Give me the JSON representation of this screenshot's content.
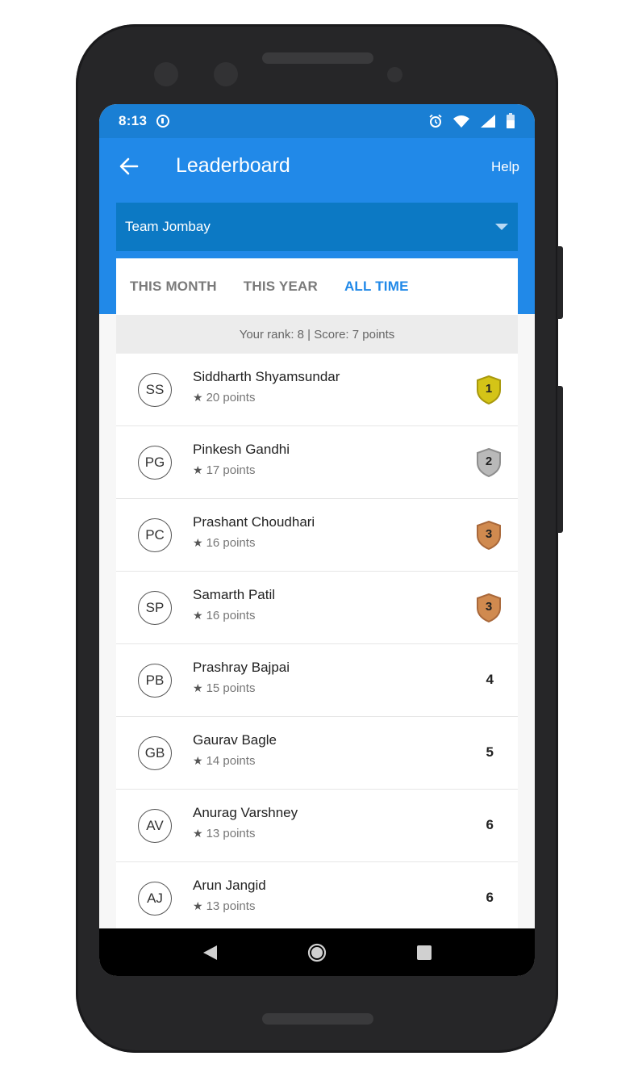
{
  "status": {
    "time": "8:13"
  },
  "appbar": {
    "title": "Leaderboard",
    "help_label": "Help"
  },
  "team_select": {
    "value": "Team Jombay"
  },
  "tabs": [
    {
      "label": "THIS MONTH",
      "active": false
    },
    {
      "label": "THIS YEAR",
      "active": false
    },
    {
      "label": "ALL TIME",
      "active": true
    }
  ],
  "your_rank": "Your rank: 8 | Score: 7 points",
  "leaders": [
    {
      "initials": "SS",
      "name": "Siddharth Shyamsundar",
      "points": "20 points",
      "rank": "1",
      "badge": "gold"
    },
    {
      "initials": "PG",
      "name": "Pinkesh Gandhi",
      "points": "17 points",
      "rank": "2",
      "badge": "silver"
    },
    {
      "initials": "PC",
      "name": "Prashant Choudhari",
      "points": "16 points",
      "rank": "3",
      "badge": "bronze"
    },
    {
      "initials": "SP",
      "name": "Samarth Patil",
      "points": "16 points",
      "rank": "3",
      "badge": "bronze"
    },
    {
      "initials": "PB",
      "name": "Prashray Bajpai",
      "points": "15 points",
      "rank": "4",
      "badge": ""
    },
    {
      "initials": "GB",
      "name": "Gaurav Bagle",
      "points": "14 points",
      "rank": "5",
      "badge": ""
    },
    {
      "initials": "AV",
      "name": "Anurag Varshney",
      "points": "13 points",
      "rank": "6",
      "badge": ""
    },
    {
      "initials": "AJ",
      "name": "Arun Jangid",
      "points": "13 points",
      "rank": "6",
      "badge": ""
    }
  ],
  "badge_colors": {
    "gold": {
      "fill": "#d4c417",
      "stroke": "#a8980c"
    },
    "silver": {
      "fill": "#b9b9b9",
      "stroke": "#8e8e8e"
    },
    "bronze": {
      "fill": "#d08a4f",
      "stroke": "#a9683a"
    }
  },
  "colors": {
    "primary": "#2189e8",
    "status_bar": "#1a7fd4",
    "dropdown": "#0c79c4"
  },
  "icons": {
    "back": "arrow-left-icon",
    "alarm": "alarm-icon",
    "wifi": "wifi-icon",
    "signal": "signal-icon",
    "battery": "battery-icon",
    "nav_back": "nav-back-icon",
    "nav_home": "nav-home-icon",
    "nav_recents": "nav-recents-icon"
  }
}
